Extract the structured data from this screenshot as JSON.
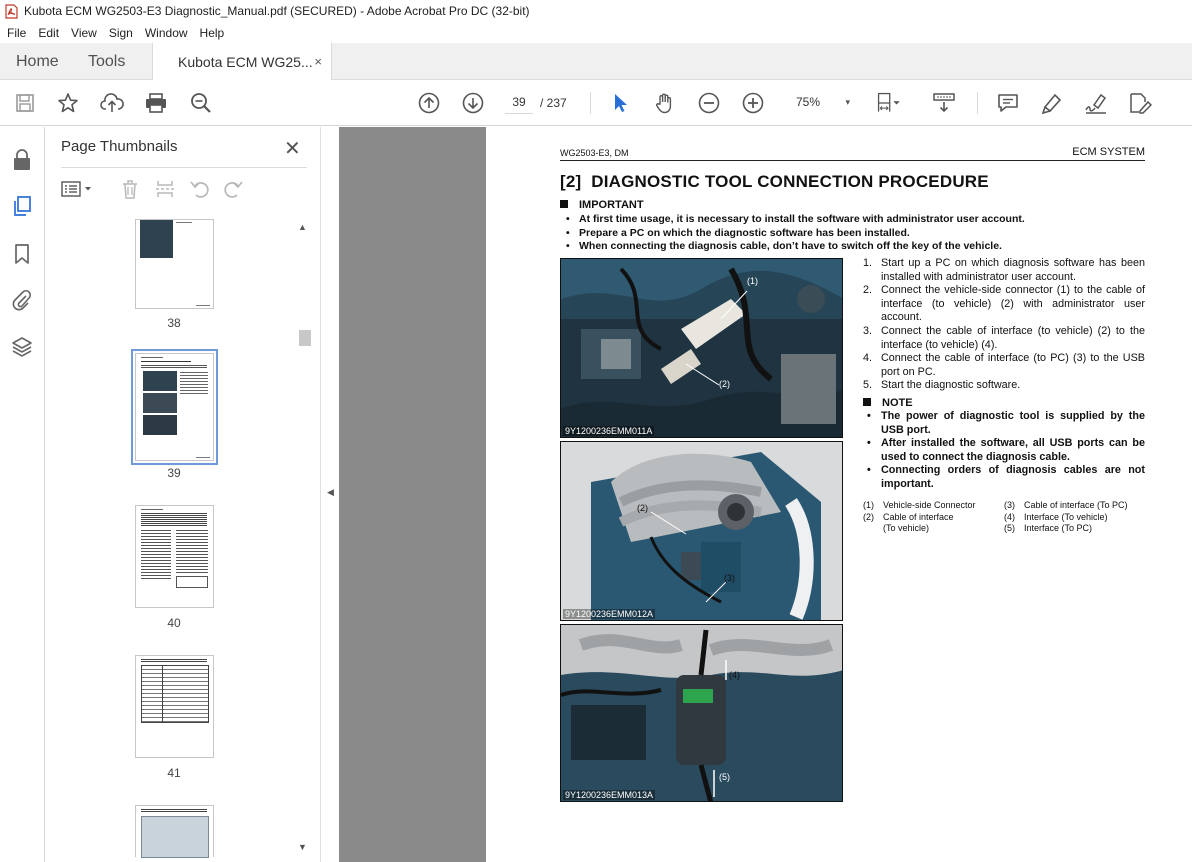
{
  "window": {
    "title": "Kubota ECM WG2503-E3 Diagnostic_Manual.pdf (SECURED) - Adobe Acrobat Pro DC (32-bit)"
  },
  "menu": [
    "File",
    "Edit",
    "View",
    "Sign",
    "Window",
    "Help"
  ],
  "tabs": {
    "home": "Home",
    "tools": "Tools",
    "document": "Kubota ECM WG25...",
    "close_glyph": "×"
  },
  "toolbar": {
    "current_page": "39",
    "page_count": "/ 237",
    "zoom": "75%",
    "zoom_caret": "▾"
  },
  "thumbnails_panel": {
    "title": "Page Thumbnails",
    "close_glyph": "✕",
    "items": [
      {
        "label": "38",
        "selected": false
      },
      {
        "label": "39",
        "selected": true
      },
      {
        "label": "40",
        "selected": false
      },
      {
        "label": "41",
        "selected": false
      }
    ]
  },
  "page": {
    "header_left": "WG2503-E3, DM",
    "header_right": "ECM SYSTEM",
    "title": "[2]  DIAGNOSTIC TOOL CONNECTION PROCEDURE",
    "important_heading": "IMPORTANT",
    "important_items": [
      "At first time usage, it is necessary to install the software with administrator user account.",
      "Prepare a PC on which the diagnostic software has been installed.",
      "When connecting the diagnosis cable, don’t have to switch off the key of the vehicle."
    ],
    "steps": [
      {
        "num": "1.",
        "text": "Start up a PC on which diagnosis software has been installed with administrator user account."
      },
      {
        "num": "2.",
        "text": "Connect the vehicle-side connector (1) to the cable of interface (to vehicle) (2) with administrator user account."
      },
      {
        "num": "3.",
        "text": "Connect the cable of interface (to vehicle) (2) to the interface (to vehicle) (4)."
      },
      {
        "num": "4.",
        "text": "Connect the cable of interface (to PC) (3) to the USB port on PC."
      },
      {
        "num": "5.",
        "text": "Start the diagnostic software."
      }
    ],
    "note_heading": "NOTE",
    "note_items": [
      "The power of diagnostic tool is supplied by the USB port.",
      "After installed the software, all USB ports can be used to connect the diagnosis cable.",
      "Connecting orders of diagnosis cables are not important."
    ],
    "legend_left": [
      {
        "k": "(1)",
        "v": "Vehicle-side Connector"
      },
      {
        "k": "(2)",
        "v": "Cable of interface"
      },
      {
        "k": "",
        "v": "(To vehicle)"
      }
    ],
    "legend_right": [
      {
        "k": "(3)",
        "v": "Cable of interface (To PC)"
      },
      {
        "k": "(4)",
        "v": "Interface (To vehicle)"
      },
      {
        "k": "(5)",
        "v": "Interface (To PC)"
      }
    ],
    "photos": [
      {
        "caption": "9Y1200236EMM011A",
        "callouts": [
          "(1)",
          "(2)"
        ]
      },
      {
        "caption": "9Y1200236EMM012A",
        "callouts": [
          "(2)",
          "(3)"
        ]
      },
      {
        "caption": "9Y1200236EMM013A",
        "callouts": [
          "(4)",
          "(5)"
        ]
      }
    ]
  }
}
